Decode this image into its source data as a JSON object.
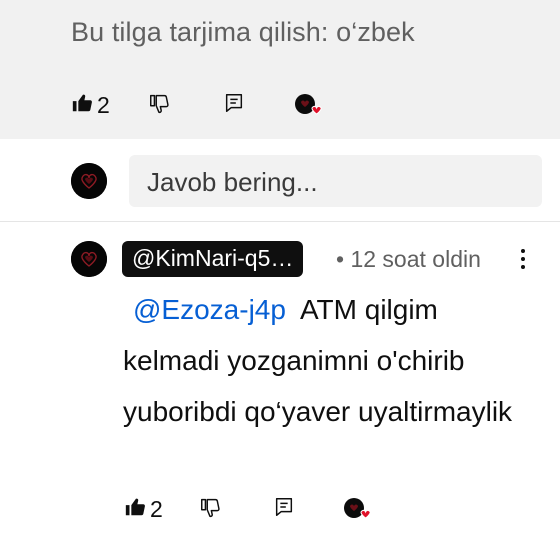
{
  "top_comment": {
    "translate_label": "Bu tilga tarjima qilish: o‘zbek",
    "likes": "2"
  },
  "reply_box": {
    "placeholder": "Javob bering..."
  },
  "reply_comment": {
    "author": "@KimNari-q5…",
    "separator": "•",
    "time": "12 soat oldin",
    "mention": "@Ezoza-j4p",
    "text": "ATM qilgim kelmadi yozganimni o'chirib yuboribdi qo‘yaver uyaltirmaylik",
    "likes": "2"
  },
  "colors": {
    "mention_link": "#065fd4",
    "heart_badge": "#e0112a",
    "secondary_text": "#606060"
  },
  "icons": [
    "thumbs-up-icon",
    "thumbs-down-icon",
    "reply-icon",
    "creator-heart-icon",
    "more-vert-icon"
  ]
}
